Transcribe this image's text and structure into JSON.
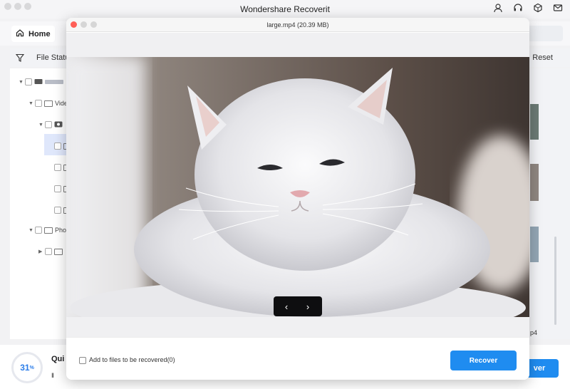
{
  "app": {
    "title": "Wondershare Recoverit",
    "home_label": "Home",
    "filter_label": "File Statu",
    "reset_label": "Reset"
  },
  "tree": {
    "items": [
      {
        "label": "",
        "icon": "drive-icon"
      },
      {
        "label": "Vide",
        "icon": "folder-icon"
      },
      {
        "label": "",
        "icon": "camera-icon"
      },
      {
        "label": "",
        "icon": "file-icon"
      },
      {
        "label": "",
        "icon": "file-icon"
      },
      {
        "label": "",
        "icon": "file-icon"
      },
      {
        "label": "",
        "icon": "file-icon"
      },
      {
        "label": "Pho",
        "icon": "folder-icon"
      },
      {
        "label": "",
        "icon": "folder-icon"
      }
    ]
  },
  "right_pane": {
    "partial_filename": "p4"
  },
  "bottom": {
    "progress_value": "31",
    "progress_unit": "%",
    "quick_label": "Qui",
    "pause_glyph": "II",
    "recover_partial": "ver"
  },
  "preview": {
    "title": "large.mp4 (20.39 MB)",
    "add_label": "Add to files to be recovered(0)",
    "recover_label": "Recover",
    "prev_glyph": "‹",
    "next_glyph": "›"
  },
  "colors": {
    "accent": "#1f8cf0",
    "close_dot": "#ff5f57",
    "inactive_dot": "#d6d6d6"
  }
}
